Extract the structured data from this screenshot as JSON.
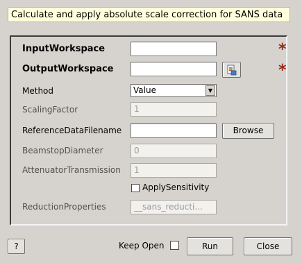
{
  "description": "Calculate and apply absolute scale correction for SANS data",
  "properties": {
    "input_workspace": {
      "label": "InputWorkspace",
      "value": ""
    },
    "output_workspace": {
      "label": "OutputWorkspace",
      "value": ""
    },
    "method": {
      "label": "Method",
      "value": "Value"
    },
    "scaling_factor": {
      "label": "ScalingFactor",
      "value": "1"
    },
    "reference_data_filename": {
      "label": "ReferenceDataFilename",
      "value": "",
      "browse_label": "Browse"
    },
    "beamstop_diameter": {
      "label": "BeamstopDiameter",
      "value": "0"
    },
    "attenuator_transmission": {
      "label": "AttenuatorTransmission",
      "value": "1"
    },
    "apply_sensitivity": {
      "label": "ApplySensitivity",
      "checked": false
    },
    "reduction_properties": {
      "label": "ReductionProperties",
      "value": "__sans_reducti..."
    }
  },
  "mandatory_marker": "*",
  "footer": {
    "help_label": "?",
    "keep_open_label": "Keep Open",
    "keep_open_checked": false,
    "run_label": "Run",
    "close_label": "Close"
  },
  "icons": {
    "workspace_picker": "workspace-picker-icon",
    "dropdown": "chevron-down-icon",
    "required": "asterisk-icon"
  },
  "colors": {
    "background": "#d6d3ce",
    "description_bg": "#ffffdc",
    "required_star": "#9a2a1c"
  }
}
